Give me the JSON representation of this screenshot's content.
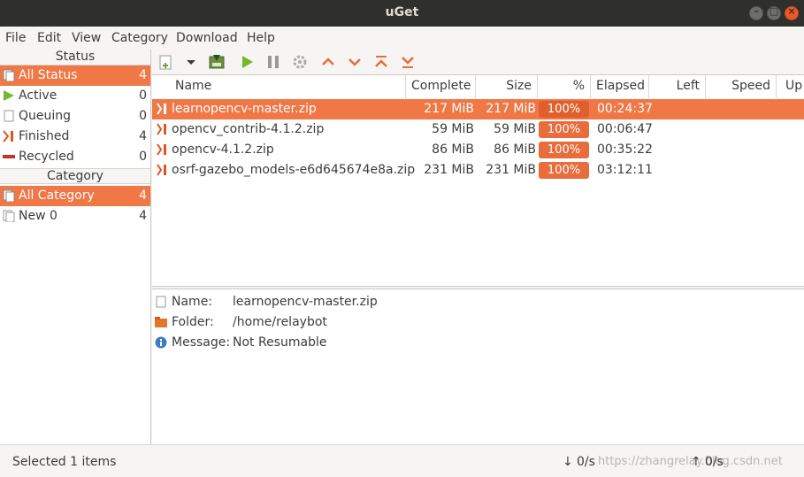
{
  "window": {
    "title": "uGet"
  },
  "menu": [
    "File",
    "Edit",
    "View",
    "Category",
    "Download",
    "Help"
  ],
  "status_panel": {
    "header": "Status",
    "items": [
      {
        "label": "All Status",
        "count": "4",
        "icon": "all-status-icon"
      },
      {
        "label": "Active",
        "count": "0",
        "icon": "play-icon"
      },
      {
        "label": "Queuing",
        "count": "0",
        "icon": "document-icon"
      },
      {
        "label": "Finished",
        "count": "4",
        "icon": "finished-icon"
      },
      {
        "label": "Recycled",
        "count": "0",
        "icon": "recycled-icon"
      }
    ]
  },
  "category_panel": {
    "header": "Category",
    "items": [
      {
        "label": "All Category",
        "count": "4",
        "icon": "all-category-icon"
      },
      {
        "label": "New 0",
        "count": "4",
        "icon": "category-icon"
      }
    ]
  },
  "columns": [
    "Name",
    "Complete",
    "Size",
    "%",
    "Elapsed",
    "Left",
    "Speed",
    "Up"
  ],
  "downloads": [
    {
      "name": "learnopencv-master.zip",
      "complete": "217 MiB",
      "size": "217 MiB",
      "percent": "100%",
      "elapsed": "00:24:37",
      "left": "",
      "speed": ""
    },
    {
      "name": "opencv_contrib-4.1.2.zip",
      "complete": "59 MiB",
      "size": "59 MiB",
      "percent": "100%",
      "elapsed": "00:06:47",
      "left": "",
      "speed": ""
    },
    {
      "name": "opencv-4.1.2.zip",
      "complete": "86 MiB",
      "size": "86 MiB",
      "percent": "100%",
      "elapsed": "00:35:22",
      "left": "",
      "speed": ""
    },
    {
      "name": "osrf-gazebo_models-e6d645674e8a.zip",
      "complete": "231 MiB",
      "size": "231 MiB",
      "percent": "100%",
      "elapsed": "03:12:11",
      "left": "",
      "speed": ""
    }
  ],
  "details": {
    "name_label": "Name:",
    "name_value": "learnopencv-master.zip",
    "folder_label": "Folder:",
    "folder_value": "/home/relaybot",
    "message_label": "Message:",
    "message_value": "Not Resumable"
  },
  "statusbar": {
    "selected": "Selected 1 items",
    "down_arrow": "↓",
    "down_speed": "0/s",
    "up_arrow": "↑",
    "up_speed": "0/s",
    "watermark": "https://zhangrelay.blog.csdn.net"
  },
  "colors": {
    "accent": "#f07746",
    "progress": "#e96c3c",
    "titlebar": "#2f2f2c"
  }
}
